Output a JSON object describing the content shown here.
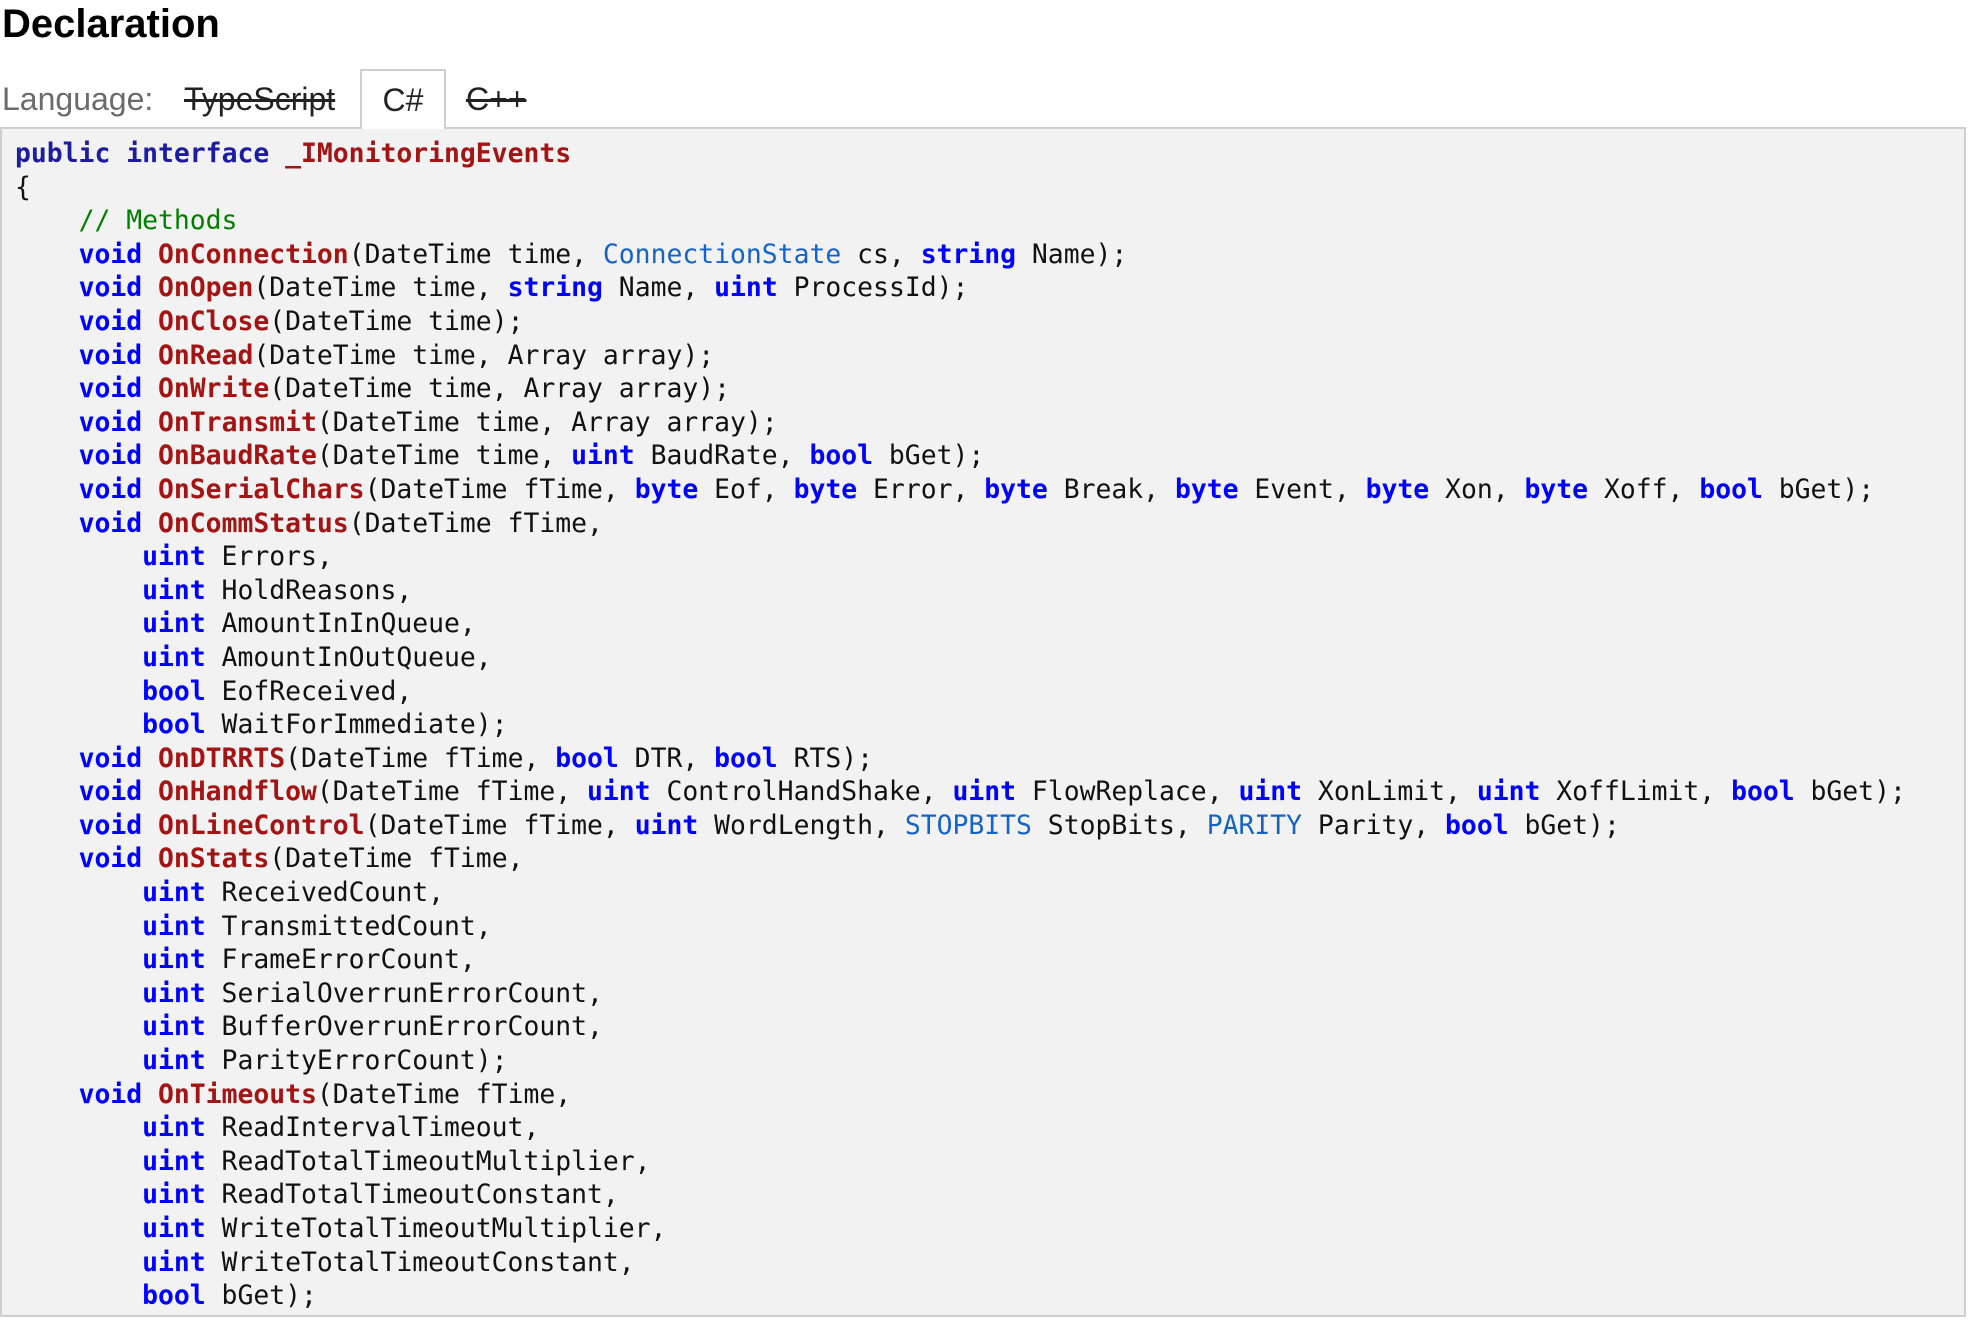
{
  "page": {
    "title": "Declaration"
  },
  "language": {
    "label": "Language:",
    "tabs": [
      {
        "label": "TypeScript",
        "state": "disabled"
      },
      {
        "label": "C#",
        "state": "active"
      },
      {
        "label": "C++",
        "state": "disabled"
      }
    ]
  },
  "colors": {
    "keyword": "#0000ff",
    "method_name": "#a31515",
    "type_name": "#1464c8",
    "comment": "#008000",
    "code_background": "#f2f2f2"
  },
  "code": {
    "lines": [
      [
        {
          "t": "public",
          "c": "kp"
        },
        {
          "t": " "
        },
        {
          "t": "interface",
          "c": "kp"
        },
        {
          "t": " "
        },
        {
          "t": "_IMonitoringEvents",
          "c": "n"
        }
      ],
      [
        {
          "t": "{"
        }
      ],
      [
        {
          "t": "    "
        },
        {
          "t": "// Methods",
          "c": "c"
        }
      ],
      [
        {
          "t": "    "
        },
        {
          "t": "void",
          "c": "k"
        },
        {
          "t": " "
        },
        {
          "t": "OnConnection",
          "c": "n"
        },
        {
          "t": "(DateTime time, "
        },
        {
          "t": "ConnectionState",
          "c": "t"
        },
        {
          "t": " cs, "
        },
        {
          "t": "string",
          "c": "k"
        },
        {
          "t": " Name);"
        }
      ],
      [
        {
          "t": "    "
        },
        {
          "t": "void",
          "c": "k"
        },
        {
          "t": " "
        },
        {
          "t": "OnOpen",
          "c": "n"
        },
        {
          "t": "(DateTime time, "
        },
        {
          "t": "string",
          "c": "k"
        },
        {
          "t": " Name, "
        },
        {
          "t": "uint",
          "c": "k"
        },
        {
          "t": " ProcessId);"
        }
      ],
      [
        {
          "t": "    "
        },
        {
          "t": "void",
          "c": "k"
        },
        {
          "t": " "
        },
        {
          "t": "OnClose",
          "c": "n"
        },
        {
          "t": "(DateTime time);"
        }
      ],
      [
        {
          "t": "    "
        },
        {
          "t": "void",
          "c": "k"
        },
        {
          "t": " "
        },
        {
          "t": "OnRead",
          "c": "n"
        },
        {
          "t": "(DateTime time, Array array);"
        }
      ],
      [
        {
          "t": "    "
        },
        {
          "t": "void",
          "c": "k"
        },
        {
          "t": " "
        },
        {
          "t": "OnWrite",
          "c": "n"
        },
        {
          "t": "(DateTime time, Array array);"
        }
      ],
      [
        {
          "t": "    "
        },
        {
          "t": "void",
          "c": "k"
        },
        {
          "t": " "
        },
        {
          "t": "OnTransmit",
          "c": "n"
        },
        {
          "t": "(DateTime time, Array array);"
        }
      ],
      [
        {
          "t": "    "
        },
        {
          "t": "void",
          "c": "k"
        },
        {
          "t": " "
        },
        {
          "t": "OnBaudRate",
          "c": "n"
        },
        {
          "t": "(DateTime time, "
        },
        {
          "t": "uint",
          "c": "k"
        },
        {
          "t": " BaudRate, "
        },
        {
          "t": "bool",
          "c": "k"
        },
        {
          "t": " bGet);"
        }
      ],
      [
        {
          "t": "    "
        },
        {
          "t": "void",
          "c": "k"
        },
        {
          "t": " "
        },
        {
          "t": "OnSerialChars",
          "c": "n"
        },
        {
          "t": "(DateTime fTime, "
        },
        {
          "t": "byte",
          "c": "k"
        },
        {
          "t": " Eof, "
        },
        {
          "t": "byte",
          "c": "k"
        },
        {
          "t": " Error, "
        },
        {
          "t": "byte",
          "c": "k"
        },
        {
          "t": " Break, "
        },
        {
          "t": "byte",
          "c": "k"
        },
        {
          "t": " Event, "
        },
        {
          "t": "byte",
          "c": "k"
        },
        {
          "t": " Xon, "
        },
        {
          "t": "byte",
          "c": "k"
        },
        {
          "t": " Xoff, "
        },
        {
          "t": "bool",
          "c": "k"
        },
        {
          "t": " bGet);"
        }
      ],
      [
        {
          "t": "    "
        },
        {
          "t": "void",
          "c": "k"
        },
        {
          "t": " "
        },
        {
          "t": "OnCommStatus",
          "c": "n"
        },
        {
          "t": "(DateTime fTime,"
        }
      ],
      [
        {
          "t": "        "
        },
        {
          "t": "uint",
          "c": "k"
        },
        {
          "t": " Errors,"
        }
      ],
      [
        {
          "t": "        "
        },
        {
          "t": "uint",
          "c": "k"
        },
        {
          "t": " HoldReasons,"
        }
      ],
      [
        {
          "t": "        "
        },
        {
          "t": "uint",
          "c": "k"
        },
        {
          "t": " AmountInInQueue,"
        }
      ],
      [
        {
          "t": "        "
        },
        {
          "t": "uint",
          "c": "k"
        },
        {
          "t": " AmountInOutQueue,"
        }
      ],
      [
        {
          "t": "        "
        },
        {
          "t": "bool",
          "c": "k"
        },
        {
          "t": " EofReceived,"
        }
      ],
      [
        {
          "t": "        "
        },
        {
          "t": "bool",
          "c": "k"
        },
        {
          "t": " WaitForImmediate);"
        }
      ],
      [
        {
          "t": "    "
        },
        {
          "t": "void",
          "c": "k"
        },
        {
          "t": " "
        },
        {
          "t": "OnDTRRTS",
          "c": "n"
        },
        {
          "t": "(DateTime fTime, "
        },
        {
          "t": "bool",
          "c": "k"
        },
        {
          "t": " DTR, "
        },
        {
          "t": "bool",
          "c": "k"
        },
        {
          "t": " RTS);"
        }
      ],
      [
        {
          "t": "    "
        },
        {
          "t": "void",
          "c": "k"
        },
        {
          "t": " "
        },
        {
          "t": "OnHandflow",
          "c": "n"
        },
        {
          "t": "(DateTime fTime, "
        },
        {
          "t": "uint",
          "c": "k"
        },
        {
          "t": " ControlHandShake, "
        },
        {
          "t": "uint",
          "c": "k"
        },
        {
          "t": " FlowReplace, "
        },
        {
          "t": "uint",
          "c": "k"
        },
        {
          "t": " XonLimit, "
        },
        {
          "t": "uint",
          "c": "k"
        },
        {
          "t": " XoffLimit, "
        },
        {
          "t": "bool",
          "c": "k"
        },
        {
          "t": " bGet);"
        }
      ],
      [
        {
          "t": "    "
        },
        {
          "t": "void",
          "c": "k"
        },
        {
          "t": " "
        },
        {
          "t": "OnLineControl",
          "c": "n"
        },
        {
          "t": "(DateTime fTime, "
        },
        {
          "t": "uint",
          "c": "k"
        },
        {
          "t": " WordLength, "
        },
        {
          "t": "STOPBITS",
          "c": "t"
        },
        {
          "t": " StopBits, "
        },
        {
          "t": "PARITY",
          "c": "t"
        },
        {
          "t": " Parity, "
        },
        {
          "t": "bool",
          "c": "k"
        },
        {
          "t": " bGet);"
        }
      ],
      [
        {
          "t": "    "
        },
        {
          "t": "void",
          "c": "k"
        },
        {
          "t": " "
        },
        {
          "t": "OnStats",
          "c": "n"
        },
        {
          "t": "(DateTime fTime,"
        }
      ],
      [
        {
          "t": "        "
        },
        {
          "t": "uint",
          "c": "k"
        },
        {
          "t": " ReceivedCount,"
        }
      ],
      [
        {
          "t": "        "
        },
        {
          "t": "uint",
          "c": "k"
        },
        {
          "t": " TransmittedCount,"
        }
      ],
      [
        {
          "t": "        "
        },
        {
          "t": "uint",
          "c": "k"
        },
        {
          "t": " FrameErrorCount,"
        }
      ],
      [
        {
          "t": "        "
        },
        {
          "t": "uint",
          "c": "k"
        },
        {
          "t": " SerialOverrunErrorCount,"
        }
      ],
      [
        {
          "t": "        "
        },
        {
          "t": "uint",
          "c": "k"
        },
        {
          "t": " BufferOverrunErrorCount,"
        }
      ],
      [
        {
          "t": "        "
        },
        {
          "t": "uint",
          "c": "k"
        },
        {
          "t": " ParityErrorCount);"
        }
      ],
      [
        {
          "t": "    "
        },
        {
          "t": "void",
          "c": "k"
        },
        {
          "t": " "
        },
        {
          "t": "OnTimeouts",
          "c": "n"
        },
        {
          "t": "(DateTime fTime,"
        }
      ],
      [
        {
          "t": "        "
        },
        {
          "t": "uint",
          "c": "k"
        },
        {
          "t": " ReadIntervalTimeout,"
        }
      ],
      [
        {
          "t": "        "
        },
        {
          "t": "uint",
          "c": "k"
        },
        {
          "t": " ReadTotalTimeoutMultiplier,"
        }
      ],
      [
        {
          "t": "        "
        },
        {
          "t": "uint",
          "c": "k"
        },
        {
          "t": " ReadTotalTimeoutConstant,"
        }
      ],
      [
        {
          "t": "        "
        },
        {
          "t": "uint",
          "c": "k"
        },
        {
          "t": " WriteTotalTimeoutMultiplier,"
        }
      ],
      [
        {
          "t": "        "
        },
        {
          "t": "uint",
          "c": "k"
        },
        {
          "t": " WriteTotalTimeoutConstant,"
        }
      ],
      [
        {
          "t": "        "
        },
        {
          "t": "bool",
          "c": "k"
        },
        {
          "t": " bGet);"
        }
      ]
    ]
  }
}
